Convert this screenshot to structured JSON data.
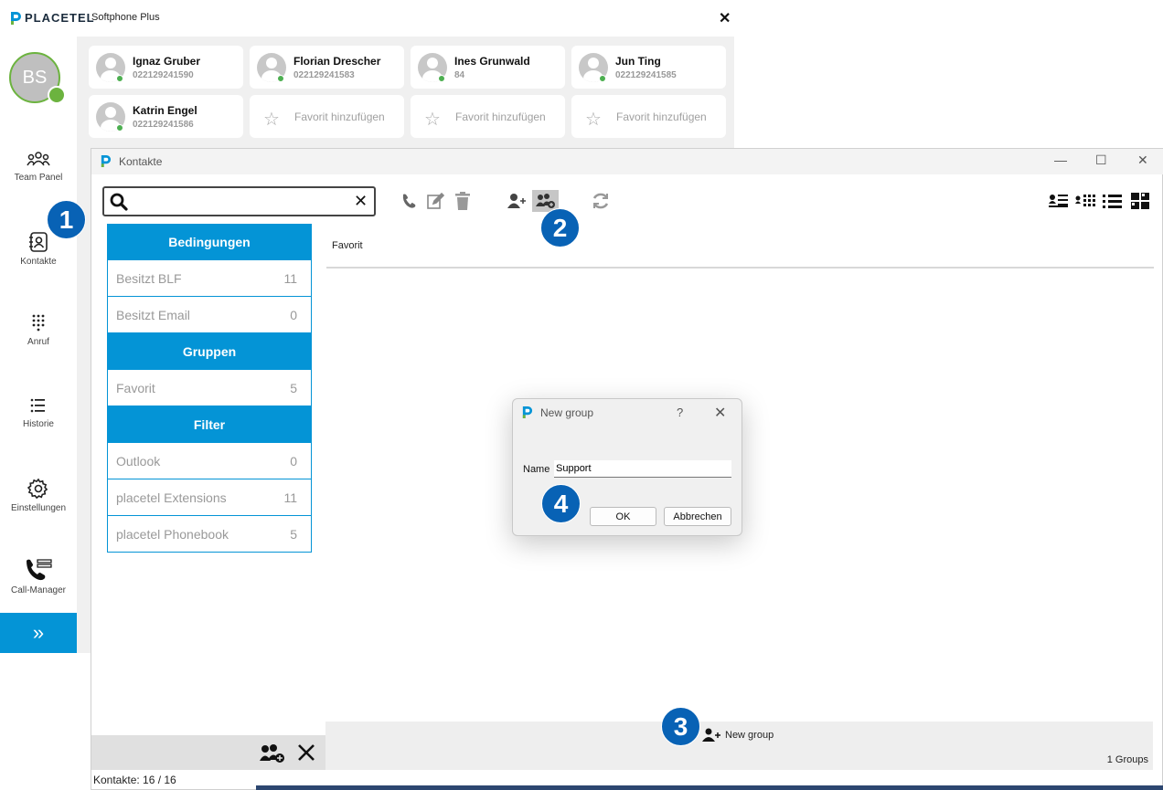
{
  "softphone": {
    "brand": "PLACETEL",
    "product": "Softphone Plus",
    "close": "✕",
    "avatar_initials": "BS",
    "nav": [
      {
        "label": "Team Panel"
      },
      {
        "label": "Kontakte"
      },
      {
        "label": "Anruf"
      },
      {
        "label": "Historie"
      },
      {
        "label": "Einstellungen"
      },
      {
        "label": "Call-Manager"
      }
    ],
    "expand": "»"
  },
  "team_panel": {
    "contacts": [
      {
        "name": "Ignaz Gruber",
        "number": "022129241590"
      },
      {
        "name": "Florian Drescher",
        "number": "022129241583"
      },
      {
        "name": "Ines Grunwald",
        "number": "84"
      },
      {
        "name": "Jun Ting",
        "number": "022129241585"
      },
      {
        "name": "Katrin Engel",
        "number": "022129241586"
      }
    ],
    "add_favorite_label": "Favorit hinzufügen"
  },
  "kontakte": {
    "title": "Kontakte",
    "search": {
      "value": "",
      "placeholder": ""
    },
    "sections": [
      {
        "header": "Bedingungen",
        "items": [
          {
            "label": "Besitzt BLF",
            "count": "11"
          },
          {
            "label": "Besitzt Email",
            "count": "0"
          }
        ]
      },
      {
        "header": "Gruppen",
        "items": [
          {
            "label": "Favorit",
            "count": "5"
          }
        ]
      },
      {
        "header": "Filter",
        "items": [
          {
            "label": "Outlook",
            "count": "0"
          },
          {
            "label": "placetel Extensions",
            "count": "11"
          },
          {
            "label": "placetel Phonebook",
            "count": "5"
          }
        ]
      }
    ],
    "group_list_header": "Favorit",
    "new_group_label": "New group",
    "groups_count": "1 Groups",
    "status": "Kontakte: 16 / 16"
  },
  "dialog": {
    "title": "New group",
    "help": "?",
    "name_label": "Name",
    "name_value": "Support",
    "ok": "OK",
    "cancel": "Abbrechen"
  },
  "badges": [
    "1",
    "2",
    "3",
    "4"
  ],
  "colors": {
    "accent": "#0494d6",
    "badge": "#0862b5",
    "online": "#6cb33f"
  }
}
